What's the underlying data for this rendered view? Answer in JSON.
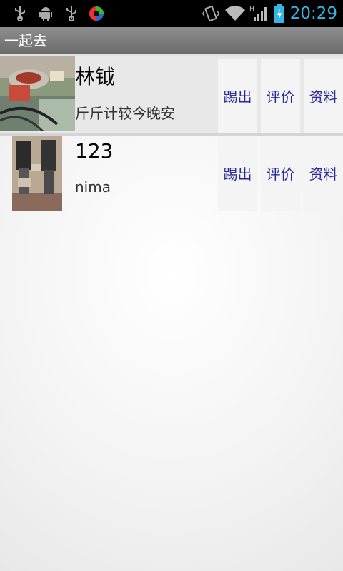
{
  "status_bar": {
    "time": "20:29",
    "icons": [
      "usb-icon",
      "android-debug-icon",
      "usb-icon",
      "app-notification-icon",
      "vibrate-icon",
      "wifi-icon",
      "signal-h-icon",
      "battery-charging-icon"
    ],
    "time_color": "#33b5e5"
  },
  "app": {
    "title": "一起去"
  },
  "members": [
    {
      "name": "林钺",
      "signature": "斤斤计较今晚安",
      "kick_label": "踢出",
      "rate_label": "评价",
      "profile_label": "资料",
      "avatar": "photo-avatar"
    },
    {
      "name": "123",
      "signature": "nima",
      "kick_label": "踢出",
      "rate_label": "评价",
      "profile_label": "资料",
      "avatar": "photo-avatar"
    }
  ],
  "colors": {
    "button_text": "#2a2a9a",
    "titlebar": "#7a7a7a"
  }
}
